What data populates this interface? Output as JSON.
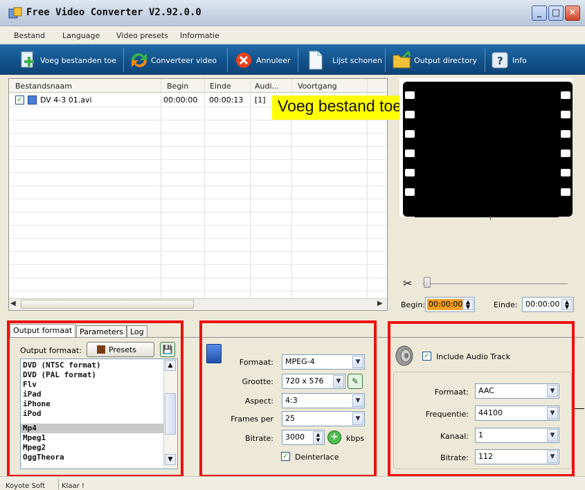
{
  "window": {
    "title": "Free Video Converter V2.92.0.0",
    "min_label": "_",
    "max_label": "□",
    "close_label": "✕"
  },
  "menu": [
    "Bestand",
    "Language",
    "Video presets",
    "Informatie"
  ],
  "toolbar": {
    "add_files": "Voeg bestanden toe",
    "convert": "Converteer video",
    "cancel": "Annuleer",
    "clear_list": "Lijst schonen",
    "output_dir": "Output directory",
    "info": "Info"
  },
  "filelist": {
    "columns": [
      "Bestandsnaam",
      "Begin",
      "Einde",
      "Audi...",
      "Voortgang"
    ],
    "rows": [
      {
        "name": "DV 4-3 01.avi",
        "begin": "00:00:00",
        "end": "00:00:13",
        "audio": "[1]",
        "progress": ""
      }
    ]
  },
  "annotation": "Voeg bestand toe",
  "preview": {
    "begin_label": "Begin:",
    "begin_value": "00:00:00",
    "end_label": "Einde:",
    "end_value": "00:00:00"
  },
  "tabs": [
    "Output formaat",
    "Parameters",
    "Log"
  ],
  "output_format": {
    "label": "Output formaat:",
    "presets_label": "Presets",
    "items": [
      "DVD (NTSC format)",
      "DVD (PAL format)",
      "Flv",
      "iPad",
      "iPhone",
      "iPod",
      "Mp4",
      "Mpeg1",
      "Mpeg2",
      "OggTheora"
    ],
    "selected": "Mp4"
  },
  "video": {
    "format_label": "Formaat:",
    "format_value": "MPEG-4",
    "size_label": "Grootte:",
    "size_value": "720 x 576",
    "aspect_label": "Aspect:",
    "aspect_value": "4:3",
    "fps_label": "Frames per",
    "fps_value": "25",
    "bitrate_label": "Bitrate:",
    "bitrate_value": "3000",
    "bitrate_unit": "kbps",
    "deinterlace_label": "Deinterlace"
  },
  "audio": {
    "include_label": "Include Audio Track",
    "format_label": "Formaat:",
    "format_value": "AAC",
    "freq_label": "Frequentie:",
    "freq_value": "44100",
    "channel_label": "Kanaal:",
    "channel_value": "1",
    "bitrate_label": "Bitrate:",
    "bitrate_value": "112"
  },
  "status": {
    "company": "Koyote Soft",
    "state": "Klaar !"
  },
  "colors": {
    "highlight": "#e11111",
    "annotation_bg": "#ffff00",
    "toolbar": "#13528a",
    "time_highlight": "#f0a020"
  }
}
